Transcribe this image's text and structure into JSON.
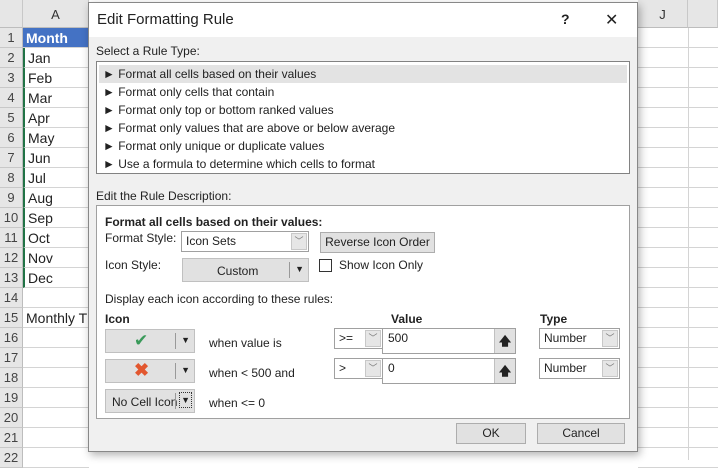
{
  "sheet": {
    "columns": [
      "A",
      "J"
    ],
    "row_numbers": [
      "1",
      "2",
      "3",
      "4",
      "5",
      "6",
      "7",
      "8",
      "9",
      "10",
      "11",
      "12",
      "13",
      "14",
      "15",
      "16",
      "17",
      "18",
      "19",
      "20",
      "21",
      "22"
    ],
    "cells": [
      "Month",
      "Jan",
      "Feb",
      "Mar",
      "Apr",
      "May",
      "Jun",
      "Jul",
      "Aug",
      "Sep",
      "Oct",
      "Nov",
      "Dec",
      "",
      "Monthly T"
    ]
  },
  "dialog": {
    "title": "Edit Formatting Rule",
    "help": "?",
    "close": "✕",
    "select_rule_type_label": "Select a Rule Type:",
    "rule_types": [
      "► Format all cells based on their values",
      "► Format only cells that contain",
      "► Format only top or bottom ranked values",
      "► Format only values that are above or below average",
      "► Format only unique or duplicate values",
      "► Use a formula to determine which cells to format"
    ],
    "edit_desc_label": "Edit the Rule Description:",
    "desc_heading": "Format all cells based on their values:",
    "format_style_label": "Format Style:",
    "format_style_value": "Icon Sets",
    "reverse_label": "Reverse Icon Order",
    "icon_style_label": "Icon Style:",
    "icon_style_value": "Custom",
    "show_icon_only_label": "Show Icon Only",
    "show_icon_only_checked": false,
    "display_rules_label": "Display each icon according to these rules:",
    "col_icon": "Icon",
    "col_value": "Value",
    "col_type": "Type",
    "rules": [
      {
        "icon": "green-check",
        "condition": "when value is",
        "operator": ">=",
        "value": "500",
        "type": "Number"
      },
      {
        "icon": "red-x",
        "condition": "when < 500 and",
        "operator": ">",
        "value": "0",
        "type": "Number"
      },
      {
        "icon_label": "No Cell Icon",
        "condition": "when <= 0"
      }
    ],
    "ok": "OK",
    "cancel": "Cancel"
  },
  "colors": {
    "header_fill": "#4472c4",
    "check": "#3a9a5a",
    "cross": "#e2572f"
  }
}
